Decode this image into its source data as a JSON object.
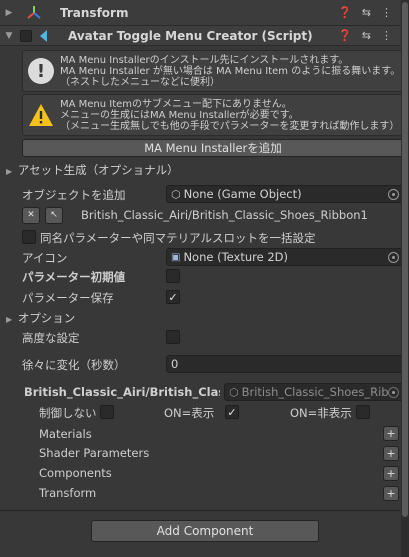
{
  "transform": {
    "title": "Transform"
  },
  "component": {
    "title": "Avatar Toggle Menu Creator (Script)"
  },
  "help1": {
    "line1": "MA Menu Installerのインストール先にインストールされます。",
    "line2": "MA Menu Installer が無い場合は MA Menu Item のように振る舞います。",
    "line3": "（ネストしたメニューなどに便利）"
  },
  "help2": {
    "line1": "MA Menu Itemのサブメニュー配下にありません。",
    "line2": "メニューの生成にはMA Menu Installerが必要です。",
    "line3": "（メニュー生成無しでも他の手段でパラメーターを変更すれば動作します）"
  },
  "add_installer_button": "MA Menu Installerを追加",
  "asset_generation_foldout": "アセット生成（オプショナル）",
  "add_object": {
    "label": "オブジェクトを追加",
    "value": "None (Game Object)"
  },
  "object_path": "British_Classic_Airi/British_Classic_Shoes_Ribbon1",
  "bulk_setting_label": "同名パラメーターや同マテリアルスロットを一括設定",
  "icon": {
    "label": "アイコン",
    "value": "None (Texture 2D)"
  },
  "param_default": {
    "label": "パラメーター初期値",
    "checked": false
  },
  "param_saved": {
    "label": "パラメーター保存",
    "checked": true
  },
  "options_foldout": "オプション",
  "advanced": {
    "label": "高度な設定",
    "checked": false
  },
  "transition": {
    "label": "徐々に変化（秒数）",
    "value": "0"
  },
  "target": {
    "path": "British_Classic_Airi/British_Classi",
    "object": "British_Classic_Shoes_Rib"
  },
  "control": {
    "no_control": {
      "label": "制御しない",
      "checked": false
    },
    "on_show": {
      "label": "ON=表示",
      "checked": true
    },
    "on_hide": {
      "label": "ON=非表示",
      "checked": false
    }
  },
  "sections": [
    "Materials",
    "Shader Parameters",
    "Components",
    "Transform"
  ],
  "plus": "+",
  "add_component_button": "Add Component"
}
